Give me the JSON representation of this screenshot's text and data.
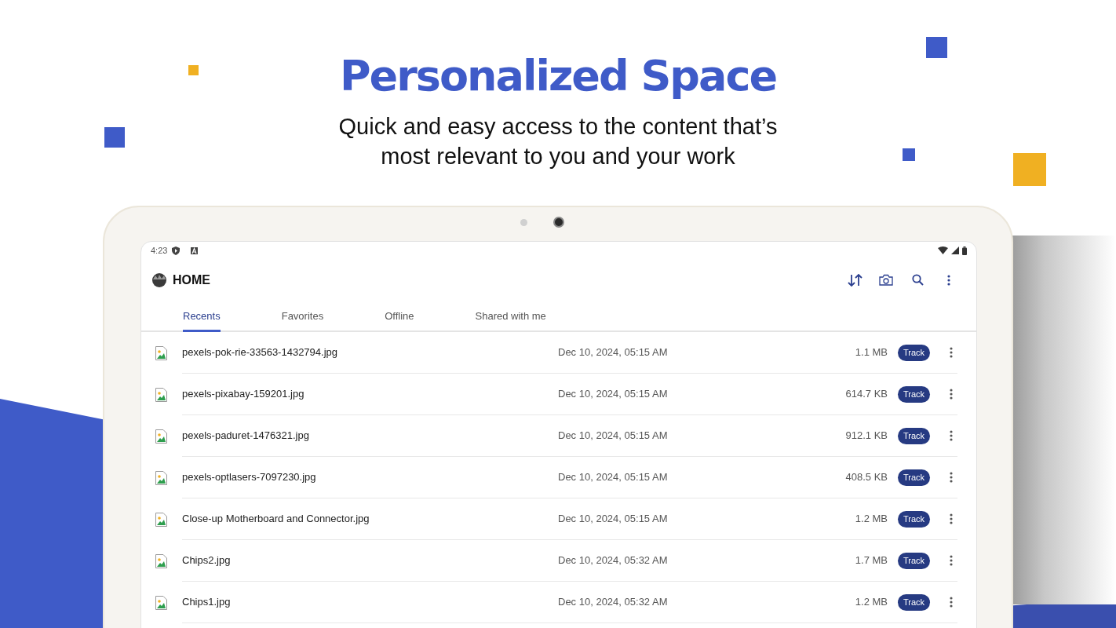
{
  "headline": "Personalized Space",
  "subtitle": "Quick and easy access to the content that’s most relevant to you and your work",
  "device": {
    "status_bar": {
      "time": "4:23"
    },
    "app_bar": {
      "title": "HOME"
    },
    "tabs": [
      {
        "label": "Recents",
        "selected": true
      },
      {
        "label": "Favorites",
        "selected": false
      },
      {
        "label": "Offline",
        "selected": false
      },
      {
        "label": "Shared with me",
        "selected": false
      }
    ],
    "files": [
      {
        "name": "pexels-pok-rie-33563-1432794.jpg",
        "modified": "Dec 10, 2024, 05:15 AM",
        "size": "1.1 MB",
        "action": "Track"
      },
      {
        "name": "pexels-pixabay-159201.jpg",
        "modified": "Dec 10, 2024, 05:15 AM",
        "size": "614.7 KB",
        "action": "Track"
      },
      {
        "name": "pexels-paduret-1476321.jpg",
        "modified": "Dec 10, 2024, 05:15 AM",
        "size": "912.1 KB",
        "action": "Track"
      },
      {
        "name": "pexels-optlasers-7097230.jpg",
        "modified": "Dec 10, 2024, 05:15 AM",
        "size": "408.5 KB",
        "action": "Track"
      },
      {
        "name": "Close-up Motherboard and Connector.jpg",
        "modified": "Dec 10, 2024, 05:15 AM",
        "size": "1.2 MB",
        "action": "Track"
      },
      {
        "name": "Chips2.jpg",
        "modified": "Dec 10, 2024, 05:32 AM",
        "size": "1.7 MB",
        "action": "Track"
      },
      {
        "name": "Chips1.jpg",
        "modified": "Dec 10, 2024, 05:32 AM",
        "size": "1.2 MB",
        "action": "Track"
      }
    ]
  }
}
